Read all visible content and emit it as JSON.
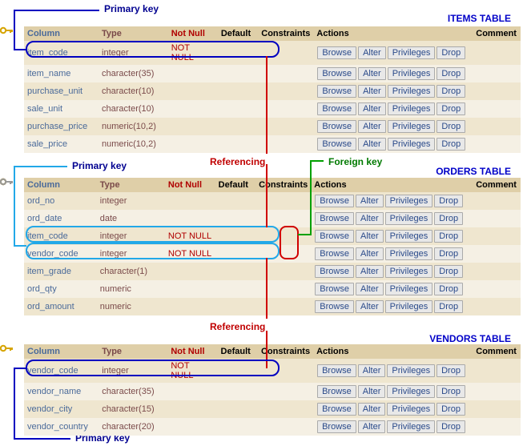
{
  "headers": {
    "col": "Column",
    "type": "Type",
    "nn": "Not Null",
    "def": "Default",
    "cons": "Constraints",
    "act": "Actions",
    "com": "Comment"
  },
  "btn": {
    "browse": "Browse",
    "alter": "Alter",
    "priv": "Privileges",
    "drop": "Drop"
  },
  "labels": {
    "pk": "Primary key",
    "ref": "Referencing",
    "fk": "Foreign key"
  },
  "titles": {
    "items": "ITEMS TABLE",
    "orders": "ORDERS TABLE",
    "vendors": "VENDORS TABLE"
  },
  "items": [
    {
      "c": "item_code",
      "t": "integer",
      "nn": "NOT NULL",
      "pk": true
    },
    {
      "c": "item_name",
      "t": "character(35)"
    },
    {
      "c": "purchase_unit",
      "t": "character(10)"
    },
    {
      "c": "sale_unit",
      "t": "character(10)"
    },
    {
      "c": "purchase_price",
      "t": "numeric(10,2)"
    },
    {
      "c": "sale_price",
      "t": "numeric(10,2)"
    }
  ],
  "orders": [
    {
      "c": "ord_no",
      "t": "integer"
    },
    {
      "c": "ord_date",
      "t": "date"
    },
    {
      "c": "item_code",
      "t": "integer",
      "nn": "NOT NULL",
      "pk": true,
      "fk": true
    },
    {
      "c": "vendor_code",
      "t": "integer",
      "nn": "NOT NULL",
      "pk": true,
      "fk": true
    },
    {
      "c": "item_grade",
      "t": "character(1)"
    },
    {
      "c": "ord_qty",
      "t": "numeric"
    },
    {
      "c": "ord_amount",
      "t": "numeric"
    }
  ],
  "vendors": [
    {
      "c": "vendor_code",
      "t": "integer",
      "nn": "NOT NULL",
      "pk": true
    },
    {
      "c": "vendor_name",
      "t": "character(35)"
    },
    {
      "c": "vendor_city",
      "t": "character(15)"
    },
    {
      "c": "vendor_country",
      "t": "character(20)"
    }
  ]
}
